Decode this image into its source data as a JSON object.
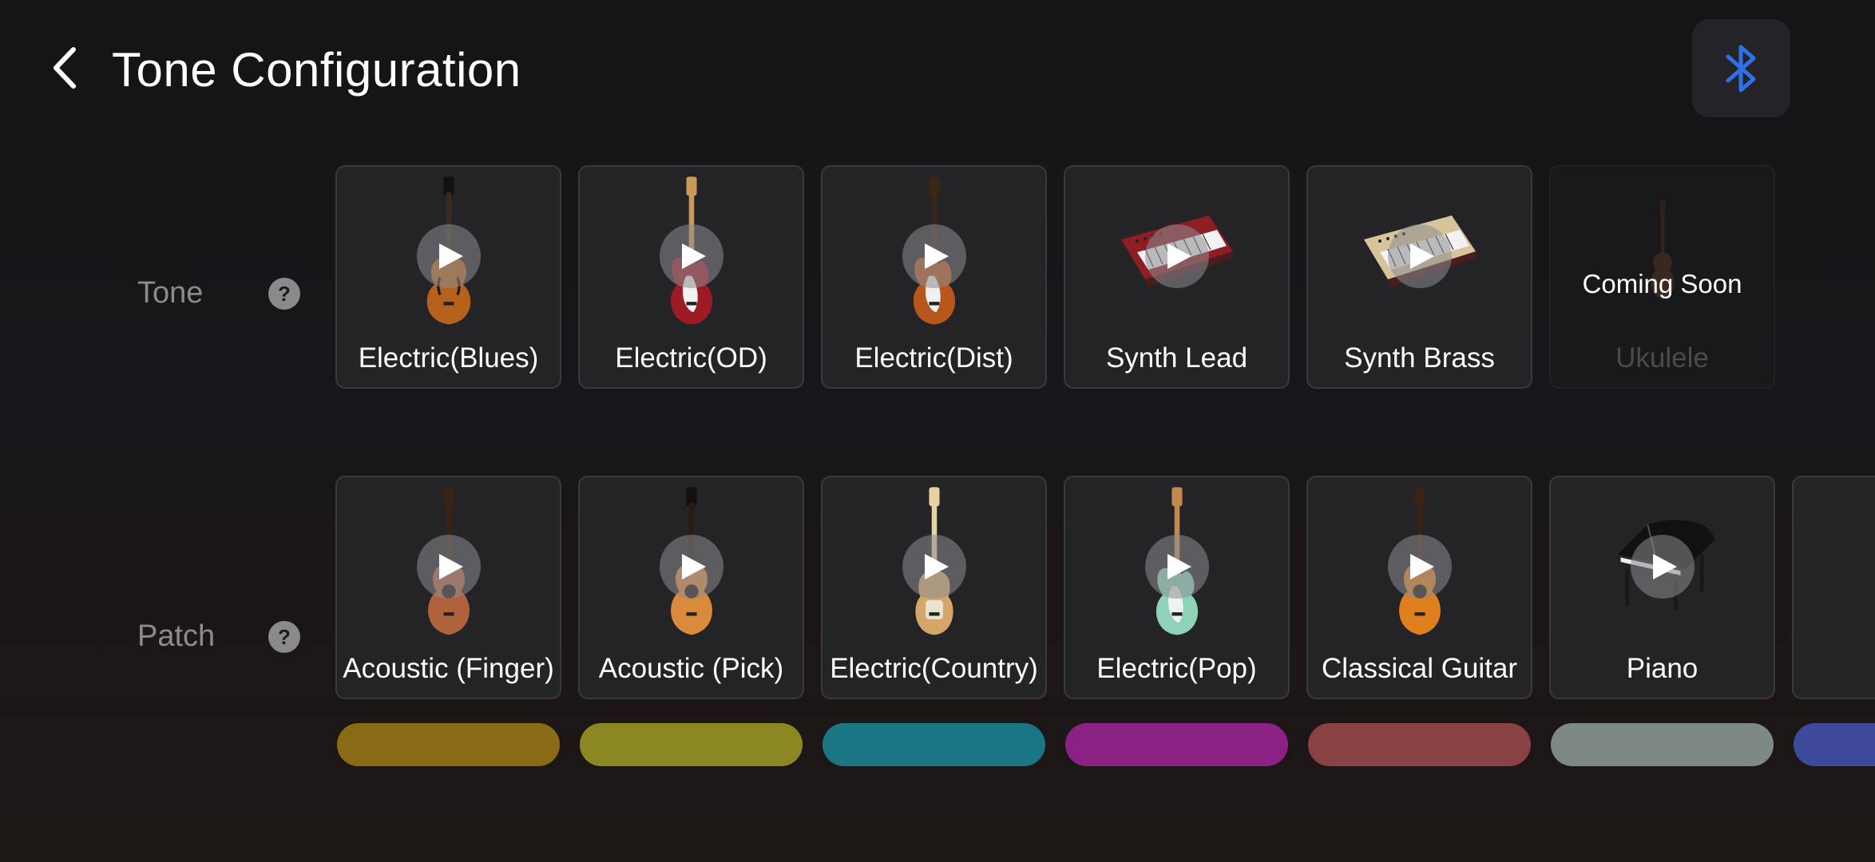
{
  "header": {
    "title": "Tone Configuration",
    "back_icon": "chevron-left-icon",
    "bluetooth_icon": "bluetooth-icon",
    "bluetooth_color": "#2f6fe8"
  },
  "tone_row": {
    "label": "Tone",
    "help_text": "?",
    "cards": [
      {
        "label": "Electric(Blues)",
        "art": "hollow-body-guitar"
      },
      {
        "label": "Electric(OD)",
        "art": "red-strat-guitar"
      },
      {
        "label": "Electric(Dist)",
        "art": "sunburst-strat-guitar"
      },
      {
        "label": "Synth Lead",
        "art": "red-synthesizer"
      },
      {
        "label": "Synth Brass",
        "art": "cream-synthesizer"
      },
      {
        "label": "Ukulele",
        "art": "ukulele",
        "disabled": true,
        "badge": "Coming Soon"
      }
    ]
  },
  "patch_row": {
    "label": "Patch",
    "help_text": "?",
    "cards": [
      {
        "label": "Acoustic (Finger)",
        "art": "acoustic-guitar"
      },
      {
        "label": "Acoustic (Pick)",
        "art": "acoustic-guitar-pick"
      },
      {
        "label": "Electric(Country)",
        "art": "telecaster-guitar"
      },
      {
        "label": "Electric(Pop)",
        "art": "mint-guitar"
      },
      {
        "label": "Classical Guitar",
        "art": "classical-guitar"
      },
      {
        "label": "Piano",
        "art": "grand-piano"
      }
    ],
    "pill_colors": [
      "#8a6a17",
      "#8b8722",
      "#1a7584",
      "#8b2283",
      "#8a4144",
      "#7e8887",
      "#3d4a9a"
    ]
  }
}
